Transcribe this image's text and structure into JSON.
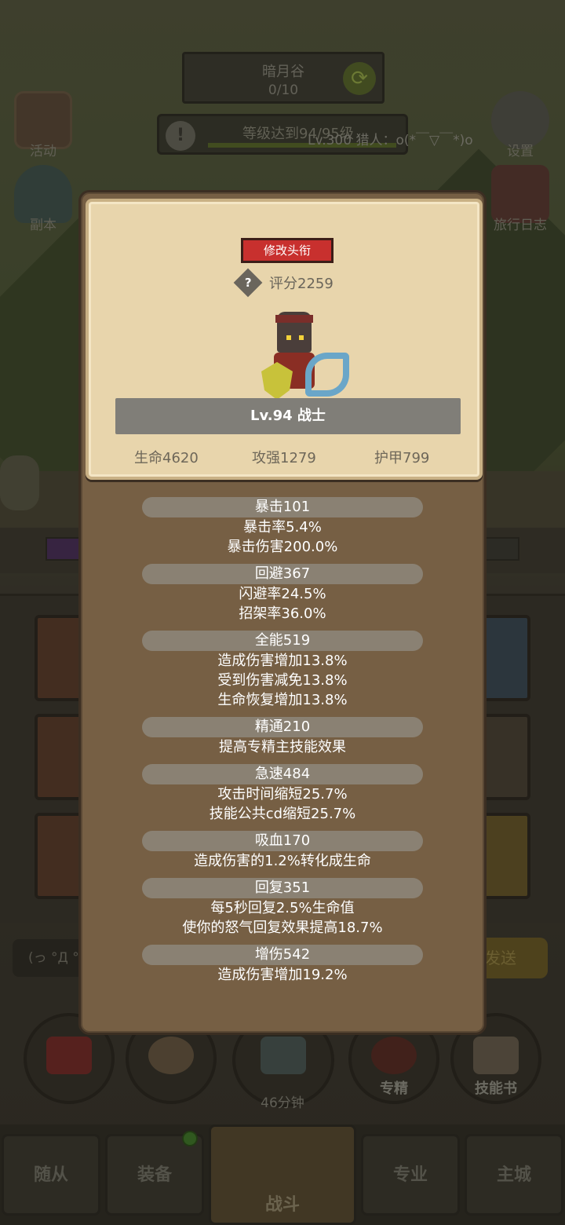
{
  "background": {
    "stage": {
      "name": "暗月谷",
      "progress": "0/10"
    },
    "quest": {
      "text": "等级达到94/95级",
      "hunter": "Lv.300 猎人：o(*￣▽￣*)o"
    },
    "side": {
      "activity": "活动",
      "dungeon": "副本",
      "settings": "设置",
      "journal": "旅行日志"
    },
    "chat": {
      "input_text": "(っ °Д °",
      "send_label": "发送"
    },
    "actions": {
      "timer": "46分钟",
      "specialty": "专精",
      "skill_book": "技能书"
    },
    "nav": {
      "followers": "随从",
      "equipment": "装备",
      "battle": "战斗",
      "profession": "专业",
      "main_city": "主城"
    }
  },
  "modal": {
    "rename_label": "修改头衔",
    "score": "评分2259",
    "class_label": "Lv.94 战士",
    "base_stats": {
      "hp": "生命4620",
      "attack": "攻强1279",
      "armor": "护甲799"
    },
    "stats": [
      {
        "head": "暴击101",
        "lines": [
          "暴击率5.4%",
          "暴击伤害200.0%"
        ]
      },
      {
        "head": "回避367",
        "lines": [
          "闪避率24.5%",
          "招架率36.0%"
        ]
      },
      {
        "head": "全能519",
        "lines": [
          "造成伤害增加13.8%",
          "受到伤害减免13.8%",
          "生命恢复增加13.8%"
        ]
      },
      {
        "head": "精通210",
        "lines": [
          "提高专精主技能效果"
        ]
      },
      {
        "head": "急速484",
        "lines": [
          "攻击时间缩短25.7%",
          "技能公共cd缩短25.7%"
        ]
      },
      {
        "head": "吸血170",
        "lines": [
          "造成伤害的1.2%转化成生命"
        ]
      },
      {
        "head": "回复351",
        "lines": [
          "每5秒回复2.5%生命值",
          "使你的怒气回复效果提高18.7%"
        ]
      },
      {
        "head": "增伤542",
        "lines": [
          "造成伤害增加19.2%"
        ]
      }
    ]
  }
}
